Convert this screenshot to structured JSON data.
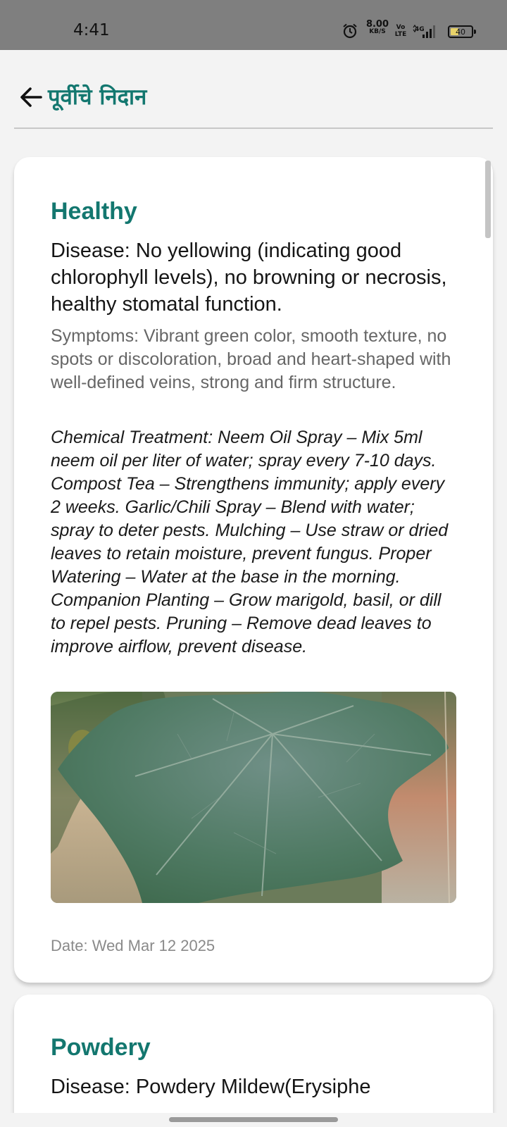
{
  "status_bar": {
    "time": "4:41",
    "net_speed_value": "8.00",
    "net_speed_unit": "KB/S",
    "volte": "Vo\nLTE",
    "network": "4G",
    "battery_level": "40",
    "battery_fraction": 0.4
  },
  "header": {
    "title": "पूर्वीचे निदान",
    "back_icon": "arrow-left-icon"
  },
  "records": [
    {
      "name": "Healthy",
      "disease": "Disease: No yellowing (indicating good chlorophyll levels), no browning or necrosis, healthy stomatal function.",
      "symptoms": "Symptoms: Vibrant green color, smooth texture, no spots or discoloration, broad and heart-shaped with well-defined veins, strong and firm structure.",
      "treatment": "Chemical Treatment: Neem Oil Spray – Mix 5ml neem oil per liter of water; spray every 7-10 days. Compost Tea – Strengthens immunity; apply every 2 weeks. Garlic/Chili Spray – Blend with water; spray to deter pests. Mulching – Use straw or dried leaves to retain moisture, prevent fungus. Proper Watering – Water at the base in the morning. Companion Planting – Grow marigold, basil, or dill to repel pests. Pruning – Remove dead leaves to improve airflow, prevent disease.",
      "date": "Date: Wed Mar 12 2025"
    },
    {
      "name": "Powdery",
      "disease": "Disease: Powdery Mildew(Erysiphe"
    }
  ],
  "colors": {
    "accent": "#13776f",
    "status_bar_bg": "#7f7f7f",
    "page_bg": "#f3f3f3",
    "card_bg": "#ffffff"
  }
}
